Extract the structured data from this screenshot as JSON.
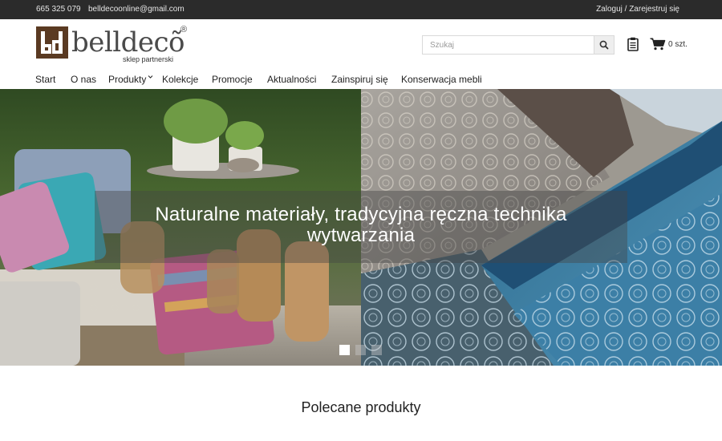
{
  "topbar": {
    "phone": "665 325 079",
    "email": "belldecoonline@gmail.com",
    "login": "Zaloguj / Zarejestruj się"
  },
  "logo": {
    "wordmark": "belldecõ",
    "registered": "®",
    "tagline": "sklep partnerski"
  },
  "search": {
    "placeholder": "Szukaj",
    "icon": "search-icon"
  },
  "cart": {
    "count_label": "0 szt.",
    "icon": "cart-icon",
    "list_icon": "clipboard-icon"
  },
  "nav": {
    "items": [
      {
        "label": "Start"
      },
      {
        "label": "O nas"
      },
      {
        "label": "Produkty",
        "dropdown": true
      },
      {
        "label": "Kolekcje"
      },
      {
        "label": "Promocje"
      },
      {
        "label": "Aktualności"
      },
      {
        "label": "Zainspiruj się"
      },
      {
        "label": "Konserwacja mebli"
      }
    ]
  },
  "hero": {
    "caption_line1": "Naturalne materiały, tradycyjna ręczna technika",
    "caption_line2": "wytwarzania",
    "slides": 3,
    "active_slide": 1
  },
  "sections": {
    "featured_title": "Polecane produkty"
  },
  "colors": {
    "topbar_bg": "#2b2b2b",
    "logo_brown": "#5a3a22",
    "text": "#222222"
  }
}
